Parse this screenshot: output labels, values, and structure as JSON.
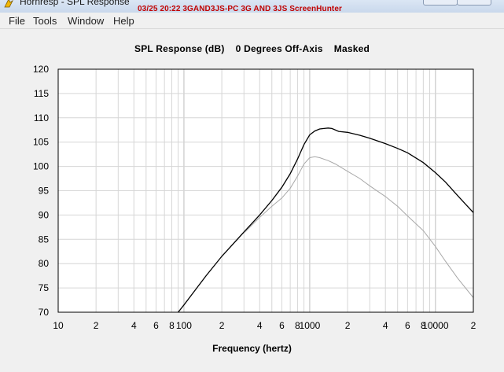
{
  "window": {
    "title": "Hornresp - SPL Response",
    "overlay": "03/25  20:22  3GAND3JS-PC  3G AND 3JS  ScreenHunter"
  },
  "menu": [
    "File",
    "Tools",
    "Window",
    "Help"
  ],
  "colors": {
    "primary": "#000000",
    "secondary": "#a8a8a8",
    "grid": "#d6d6d6",
    "overlay": "#c00000"
  },
  "chart_data": {
    "type": "line",
    "title": "SPL Response (dB)    0 Degrees Off-Axis    Masked",
    "xlabel": "Frequency (hertz)",
    "ylabel": "",
    "xscale": "log",
    "xlim": [
      10,
      20000
    ],
    "ylim": [
      70,
      120
    ],
    "yticks": [
      70,
      75,
      80,
      85,
      90,
      95,
      100,
      105,
      110,
      115,
      120
    ],
    "xtick_labels": [
      {
        "v": 10,
        "t": "10"
      },
      {
        "v": 20,
        "t": "2"
      },
      {
        "v": 40,
        "t": "4"
      },
      {
        "v": 60,
        "t": "6"
      },
      {
        "v": 80,
        "t": "8"
      },
      {
        "v": 100,
        "t": "100"
      },
      {
        "v": 200,
        "t": "2"
      },
      {
        "v": 400,
        "t": "4"
      },
      {
        "v": 600,
        "t": "6"
      },
      {
        "v": 800,
        "t": "8"
      },
      {
        "v": 1000,
        "t": "1000"
      },
      {
        "v": 2000,
        "t": "2"
      },
      {
        "v": 4000,
        "t": "4"
      },
      {
        "v": 6000,
        "t": "6"
      },
      {
        "v": 8000,
        "t": "8"
      },
      {
        "v": 10000,
        "t": "10000"
      },
      {
        "v": 20000,
        "t": "2"
      }
    ],
    "grid": true,
    "series": [
      {
        "color": "#000000",
        "x": [
          90,
          100,
          150,
          200,
          300,
          400,
          500,
          600,
          700,
          800,
          900,
          1000,
          1100,
          1200,
          1300,
          1400,
          1500,
          1700,
          2000,
          2500,
          3000,
          4000,
          5000,
          6000,
          8000,
          10000,
          12000,
          15000,
          20000
        ],
        "y": [
          70,
          71.5,
          77.5,
          81.5,
          86.5,
          90,
          93,
          95.7,
          98.5,
          101.5,
          104.5,
          106.5,
          107.3,
          107.7,
          107.8,
          107.9,
          107.8,
          107.2,
          107,
          106.4,
          105.8,
          104.7,
          103.7,
          102.8,
          100.8,
          98.7,
          96.8,
          94,
          90.5
        ]
      },
      {
        "color": "#a8a8a8",
        "x": [
          300,
          400,
          500,
          600,
          700,
          800,
          900,
          1000,
          1100,
          1200,
          1400,
          1600,
          2000,
          2500,
          3000,
          4000,
          5000,
          6000,
          8000,
          10000,
          12000,
          15000,
          20000
        ],
        "y": [
          86.3,
          89.5,
          91.8,
          93.5,
          95.5,
          98,
          100.5,
          101.8,
          102,
          101.8,
          101.2,
          100.5,
          99,
          97.5,
          96,
          93.8,
          91.8,
          89.8,
          86.8,
          83.5,
          80.5,
          77,
          73
        ]
      }
    ]
  }
}
